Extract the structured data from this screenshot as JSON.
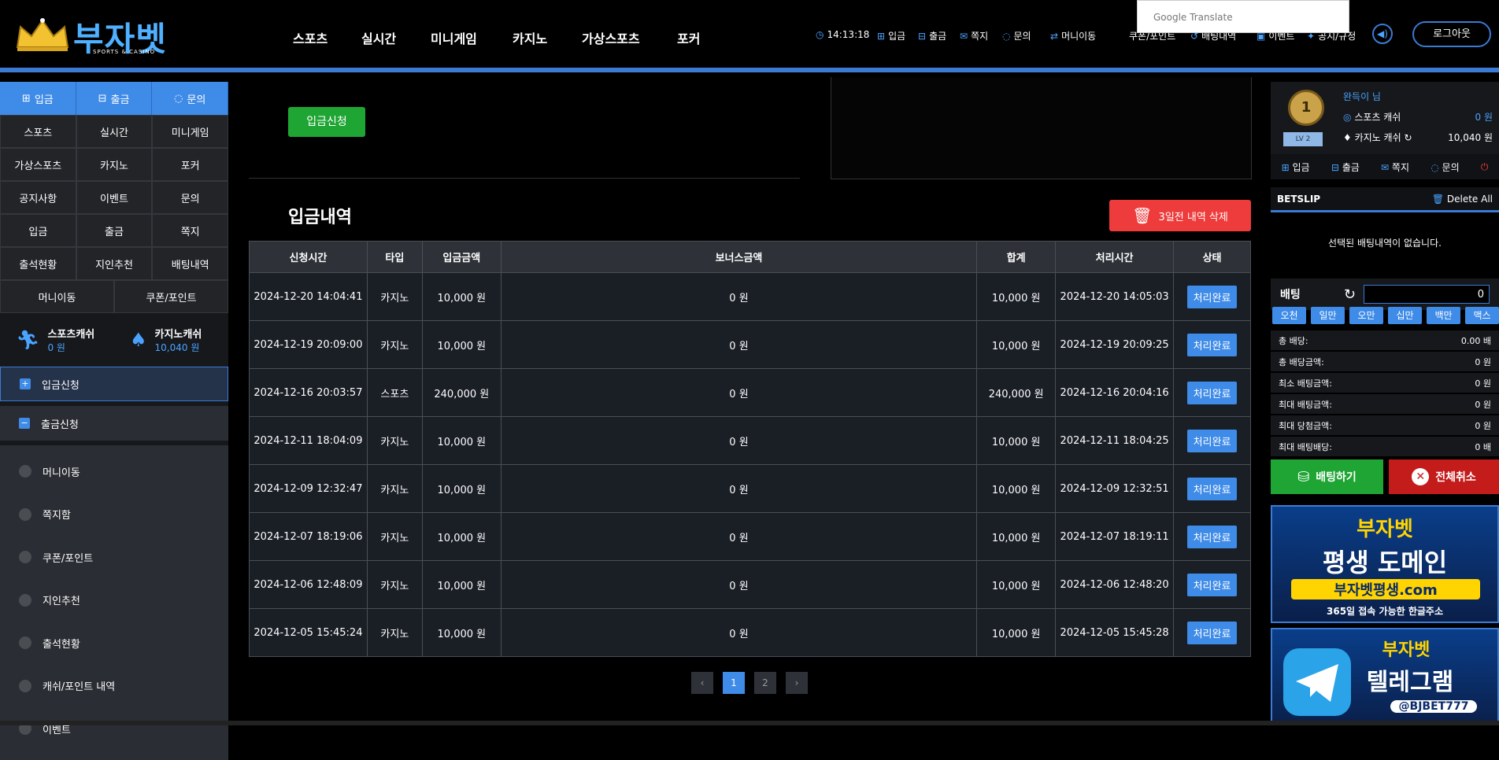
{
  "header": {
    "logo": "부자벳",
    "logo_sub": "SPORTS & CASINO",
    "nav": [
      "스포츠",
      "실시간",
      "미니게임",
      "카지노",
      "가상스포츠",
      "포커"
    ],
    "time": "14:13:18",
    "links": [
      "입금",
      "출금",
      "쪽지",
      "문의",
      "머니이동",
      "쿠폰/포인트",
      "배팅내역",
      "이벤트",
      "공지/규정"
    ],
    "google_translate": "Google Translate",
    "logout": "로그아웃"
  },
  "left": {
    "top_buttons": [
      "입금",
      "출금",
      "문의"
    ],
    "grid": [
      "스포츠",
      "실시간",
      "미니게임",
      "가상스포츠",
      "카지노",
      "포커",
      "공지사항",
      "이벤트",
      "문의",
      "입금",
      "출금",
      "쪽지",
      "출석현황",
      "지인추천",
      "배팅내역"
    ],
    "grid2": [
      "머니이동",
      "쿠폰/포인트"
    ],
    "sports_cash_label": "스포츠캐쉬",
    "sports_cash_value": "0 원",
    "casino_cash_label": "카지노캐쉬",
    "casino_cash_value": "10,040 원",
    "deposit_request": "입금신청",
    "withdraw_request": "출금신청",
    "sub_items": [
      "머니이동",
      "쪽지함",
      "쿠폰/포인트",
      "지인추천",
      "출석현황",
      "캐쉬/포인트 내역",
      "이벤트"
    ]
  },
  "main": {
    "deposit_button": "입금신청",
    "title": "입금내역",
    "delete_button": "3일전 내역 삭제",
    "columns": [
      "신청시간",
      "타입",
      "입금금액",
      "보너스금액",
      "합계",
      "처리시간",
      "상태"
    ],
    "rows": [
      {
        "req": "2024-12-20 14:04:41",
        "type": "카지노",
        "amount": "10,000 원",
        "bonus": "0 원",
        "total": "10,000 원",
        "done": "2024-12-20 14:05:03",
        "status": "처리완료"
      },
      {
        "req": "2024-12-19 20:09:00",
        "type": "카지노",
        "amount": "10,000 원",
        "bonus": "0 원",
        "total": "10,000 원",
        "done": "2024-12-19 20:09:25",
        "status": "처리완료"
      },
      {
        "req": "2024-12-16 20:03:57",
        "type": "스포츠",
        "amount": "240,000 원",
        "bonus": "0 원",
        "total": "240,000 원",
        "done": "2024-12-16 20:04:16",
        "status": "처리완료"
      },
      {
        "req": "2024-12-11 18:04:09",
        "type": "카지노",
        "amount": "10,000 원",
        "bonus": "0 원",
        "total": "10,000 원",
        "done": "2024-12-11 18:04:25",
        "status": "처리완료"
      },
      {
        "req": "2024-12-09 12:32:47",
        "type": "카지노",
        "amount": "10,000 원",
        "bonus": "0 원",
        "total": "10,000 원",
        "done": "2024-12-09 12:32:51",
        "status": "처리완료"
      },
      {
        "req": "2024-12-07 18:19:06",
        "type": "카지노",
        "amount": "10,000 원",
        "bonus": "0 원",
        "total": "10,000 원",
        "done": "2024-12-07 18:19:11",
        "status": "처리완료"
      },
      {
        "req": "2024-12-06 12:48:09",
        "type": "카지노",
        "amount": "10,000 원",
        "bonus": "0 원",
        "total": "10,000 원",
        "done": "2024-12-06 12:48:20",
        "status": "처리완료"
      },
      {
        "req": "2024-12-05 15:45:24",
        "type": "카지노",
        "amount": "10,000 원",
        "bonus": "0 원",
        "total": "10,000 원",
        "done": "2024-12-05 15:45:28",
        "status": "처리완료"
      }
    ],
    "pages": [
      "1",
      "2"
    ],
    "current_page": "1"
  },
  "right": {
    "medal": "1",
    "level": "LV 2",
    "username": "완득이 님",
    "sports_cash_label": "스포츠 캐쉬",
    "sports_cash_value": "0 원",
    "casino_cash_label": "카지노 캐쉬",
    "casino_cash_value": "10,040 원",
    "links": [
      "입금",
      "출금",
      "쪽지",
      "문의"
    ],
    "betslip": "BETSLIP",
    "delete_all": "Delete All",
    "empty": "선택된 배팅내역이 없습니다.",
    "bet_label": "배팅",
    "bet_value": "0",
    "amount_buttons": [
      "오천",
      "일만",
      "오만",
      "십만",
      "백만",
      "맥스"
    ],
    "info": [
      {
        "label": "총 배당:",
        "value": "0.00 배"
      },
      {
        "label": "총 배당금액:",
        "value": "0 원"
      },
      {
        "label": "최소 배팅금액:",
        "value": "0 원"
      },
      {
        "label": "최대 배팅금액:",
        "value": "0 원"
      },
      {
        "label": "최대 당첨금액:",
        "value": "0 원"
      },
      {
        "label": "최대 배팅배당:",
        "value": "0 배"
      }
    ],
    "place_bet": "배팅하기",
    "cancel_all": "전체취소",
    "banner1_brand": "부자벳",
    "banner1_line": "평생 도메인",
    "banner1_domain": "부자벳평생.com",
    "banner1_sub": "365일 접속 가능한 한글주소",
    "banner2_brand": "부자벳",
    "banner2_line": "텔레그램",
    "banner2_handle": "@BJBET777"
  }
}
